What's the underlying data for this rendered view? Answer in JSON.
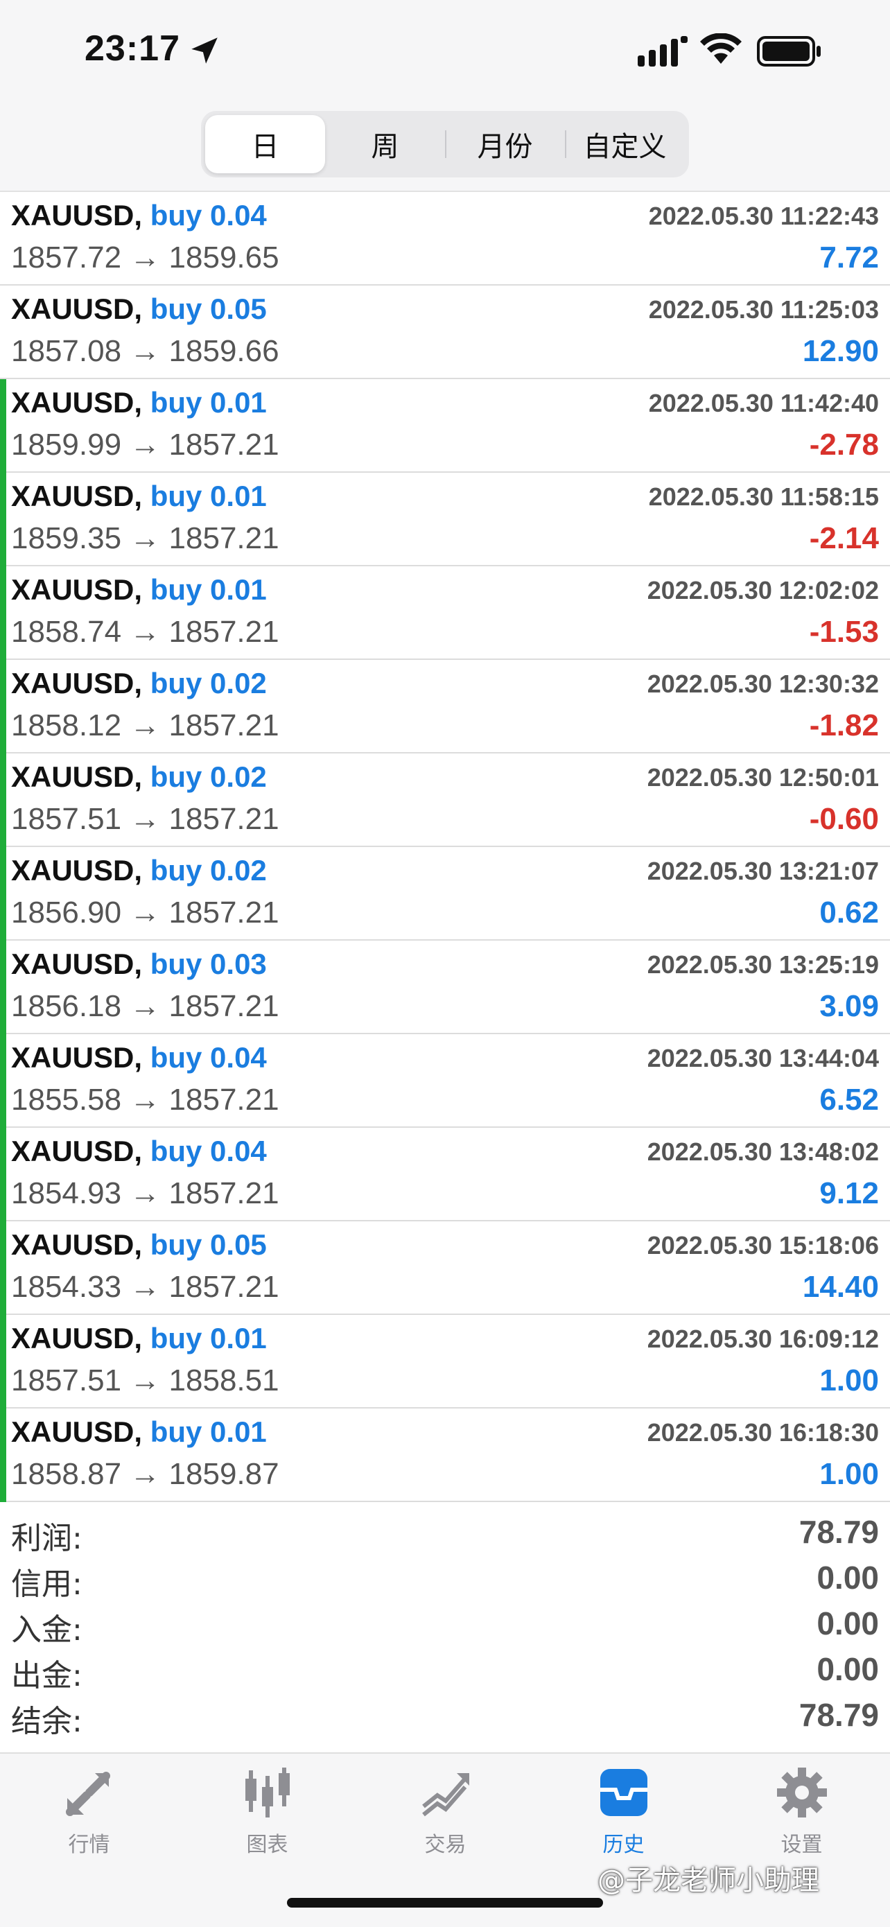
{
  "status_bar": {
    "time": "23:17"
  },
  "period_tabs": [
    {
      "label": "日",
      "active": true
    },
    {
      "label": "周",
      "active": false
    },
    {
      "label": "月份",
      "active": false
    },
    {
      "label": "自定义",
      "active": false
    }
  ],
  "trades": [
    {
      "symbol": "XAUUSD,",
      "side": "buy 0.04",
      "open": "1857.72",
      "arrow": "→",
      "close": "1859.65",
      "time": "2022.05.30 11:22:43",
      "profit": "7.72",
      "positive": true,
      "bar": false
    },
    {
      "symbol": "XAUUSD,",
      "side": "buy 0.05",
      "open": "1857.08",
      "arrow": "→",
      "close": "1859.66",
      "time": "2022.05.30 11:25:03",
      "profit": "12.90",
      "positive": true,
      "bar": false
    },
    {
      "symbol": "XAUUSD,",
      "side": "buy 0.01",
      "open": "1859.99",
      "arrow": "→",
      "close": "1857.21",
      "time": "2022.05.30 11:42:40",
      "profit": "-2.78",
      "positive": false,
      "bar": true
    },
    {
      "symbol": "XAUUSD,",
      "side": "buy 0.01",
      "open": "1859.35",
      "arrow": "→",
      "close": "1857.21",
      "time": "2022.05.30 11:58:15",
      "profit": "-2.14",
      "positive": false,
      "bar": true
    },
    {
      "symbol": "XAUUSD,",
      "side": "buy 0.01",
      "open": "1858.74",
      "arrow": "→",
      "close": "1857.21",
      "time": "2022.05.30 12:02:02",
      "profit": "-1.53",
      "positive": false,
      "bar": true
    },
    {
      "symbol": "XAUUSD,",
      "side": "buy 0.02",
      "open": "1858.12",
      "arrow": "→",
      "close": "1857.21",
      "time": "2022.05.30 12:30:32",
      "profit": "-1.82",
      "positive": false,
      "bar": true
    },
    {
      "symbol": "XAUUSD,",
      "side": "buy 0.02",
      "open": "1857.51",
      "arrow": "→",
      "close": "1857.21",
      "time": "2022.05.30 12:50:01",
      "profit": "-0.60",
      "positive": false,
      "bar": true
    },
    {
      "symbol": "XAUUSD,",
      "side": "buy 0.02",
      "open": "1856.90",
      "arrow": "→",
      "close": "1857.21",
      "time": "2022.05.30 13:21:07",
      "profit": "0.62",
      "positive": true,
      "bar": true
    },
    {
      "symbol": "XAUUSD,",
      "side": "buy 0.03",
      "open": "1856.18",
      "arrow": "→",
      "close": "1857.21",
      "time": "2022.05.30 13:25:19",
      "profit": "3.09",
      "positive": true,
      "bar": true
    },
    {
      "symbol": "XAUUSD,",
      "side": "buy 0.04",
      "open": "1855.58",
      "arrow": "→",
      "close": "1857.21",
      "time": "2022.05.30 13:44:04",
      "profit": "6.52",
      "positive": true,
      "bar": true
    },
    {
      "symbol": "XAUUSD,",
      "side": "buy 0.04",
      "open": "1854.93",
      "arrow": "→",
      "close": "1857.21",
      "time": "2022.05.30 13:48:02",
      "profit": "9.12",
      "positive": true,
      "bar": true
    },
    {
      "symbol": "XAUUSD,",
      "side": "buy 0.05",
      "open": "1854.33",
      "arrow": "→",
      "close": "1857.21",
      "time": "2022.05.30 15:18:06",
      "profit": "14.40",
      "positive": true,
      "bar": true
    },
    {
      "symbol": "XAUUSD,",
      "side": "buy 0.01",
      "open": "1857.51",
      "arrow": "→",
      "close": "1858.51",
      "time": "2022.05.30 16:09:12",
      "profit": "1.00",
      "positive": true,
      "bar": true
    },
    {
      "symbol": "XAUUSD,",
      "side": "buy 0.01",
      "open": "1858.87",
      "arrow": "→",
      "close": "1859.87",
      "time": "2022.05.30 16:18:30",
      "profit": "1.00",
      "positive": true,
      "bar": true
    }
  ],
  "summary": [
    {
      "label": "利润:",
      "value": "78.79"
    },
    {
      "label": "信用:",
      "value": "0.00"
    },
    {
      "label": "入金:",
      "value": "0.00"
    },
    {
      "label": "出金:",
      "value": "0.00"
    },
    {
      "label": "结余:",
      "value": "78.79"
    }
  ],
  "tab_bar": [
    {
      "label": "行情",
      "icon": "quotes-icon",
      "active": false
    },
    {
      "label": "图表",
      "icon": "chart-icon",
      "active": false
    },
    {
      "label": "交易",
      "icon": "trade-icon",
      "active": false
    },
    {
      "label": "历史",
      "icon": "history-icon",
      "active": true
    },
    {
      "label": "设置",
      "icon": "settings-icon",
      "active": false
    }
  ],
  "watermark": "@子龙老师小助理",
  "colors": {
    "accent": "#1a7de0",
    "loss": "#d8322b",
    "bar": "#1fad39",
    "inactive_icon": "#8e8e93"
  }
}
